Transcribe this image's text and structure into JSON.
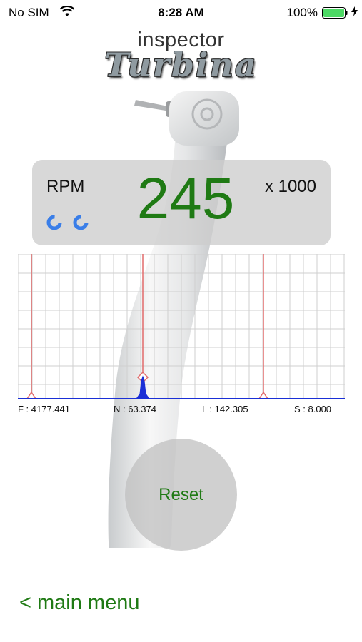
{
  "status_bar": {
    "carrier": "No SIM",
    "time": "8:28 AM",
    "battery": "100%"
  },
  "logo": {
    "top": "inspector",
    "main": "Turbina"
  },
  "rpm": {
    "label": "RPM",
    "value": "245",
    "multiplier": "x 1000"
  },
  "chart_data": {
    "type": "line",
    "labels": {
      "F": "F : 4177.441",
      "N": "N : 63.374",
      "L": "L : 142.305",
      "S": "S : 8.000"
    }
  },
  "controls": {
    "reset_label": "Reset",
    "main_menu_label": "< main menu"
  },
  "colors": {
    "accent_green": "#1f7a14",
    "marker_red": "#e26b6b",
    "baseline_blue": "#1a2fd6",
    "grid": "#cfcfcf"
  }
}
